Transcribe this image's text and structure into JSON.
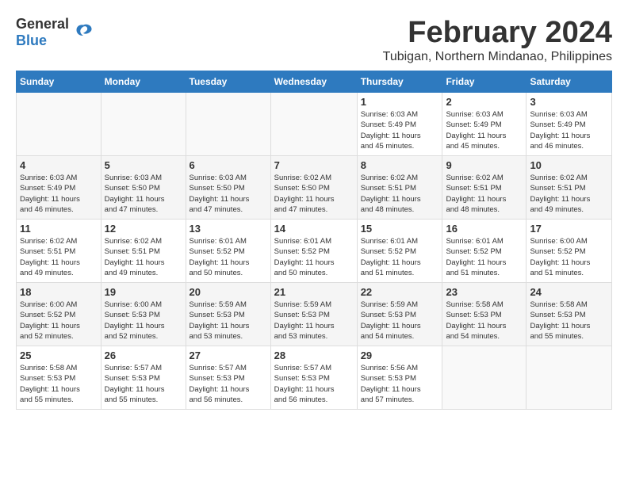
{
  "logo": {
    "general": "General",
    "blue": "Blue"
  },
  "title": {
    "month_year": "February 2024",
    "location": "Tubigan, Northern Mindanao, Philippines"
  },
  "days_of_week": [
    "Sunday",
    "Monday",
    "Tuesday",
    "Wednesday",
    "Thursday",
    "Friday",
    "Saturday"
  ],
  "weeks": [
    [
      {
        "day": "",
        "info": ""
      },
      {
        "day": "",
        "info": ""
      },
      {
        "day": "",
        "info": ""
      },
      {
        "day": "",
        "info": ""
      },
      {
        "day": "1",
        "info": "Sunrise: 6:03 AM\nSunset: 5:49 PM\nDaylight: 11 hours\nand 45 minutes."
      },
      {
        "day": "2",
        "info": "Sunrise: 6:03 AM\nSunset: 5:49 PM\nDaylight: 11 hours\nand 45 minutes."
      },
      {
        "day": "3",
        "info": "Sunrise: 6:03 AM\nSunset: 5:49 PM\nDaylight: 11 hours\nand 46 minutes."
      }
    ],
    [
      {
        "day": "4",
        "info": "Sunrise: 6:03 AM\nSunset: 5:49 PM\nDaylight: 11 hours\nand 46 minutes."
      },
      {
        "day": "5",
        "info": "Sunrise: 6:03 AM\nSunset: 5:50 PM\nDaylight: 11 hours\nand 47 minutes."
      },
      {
        "day": "6",
        "info": "Sunrise: 6:03 AM\nSunset: 5:50 PM\nDaylight: 11 hours\nand 47 minutes."
      },
      {
        "day": "7",
        "info": "Sunrise: 6:02 AM\nSunset: 5:50 PM\nDaylight: 11 hours\nand 47 minutes."
      },
      {
        "day": "8",
        "info": "Sunrise: 6:02 AM\nSunset: 5:51 PM\nDaylight: 11 hours\nand 48 minutes."
      },
      {
        "day": "9",
        "info": "Sunrise: 6:02 AM\nSunset: 5:51 PM\nDaylight: 11 hours\nand 48 minutes."
      },
      {
        "day": "10",
        "info": "Sunrise: 6:02 AM\nSunset: 5:51 PM\nDaylight: 11 hours\nand 49 minutes."
      }
    ],
    [
      {
        "day": "11",
        "info": "Sunrise: 6:02 AM\nSunset: 5:51 PM\nDaylight: 11 hours\nand 49 minutes."
      },
      {
        "day": "12",
        "info": "Sunrise: 6:02 AM\nSunset: 5:51 PM\nDaylight: 11 hours\nand 49 minutes."
      },
      {
        "day": "13",
        "info": "Sunrise: 6:01 AM\nSunset: 5:52 PM\nDaylight: 11 hours\nand 50 minutes."
      },
      {
        "day": "14",
        "info": "Sunrise: 6:01 AM\nSunset: 5:52 PM\nDaylight: 11 hours\nand 50 minutes."
      },
      {
        "day": "15",
        "info": "Sunrise: 6:01 AM\nSunset: 5:52 PM\nDaylight: 11 hours\nand 51 minutes."
      },
      {
        "day": "16",
        "info": "Sunrise: 6:01 AM\nSunset: 5:52 PM\nDaylight: 11 hours\nand 51 minutes."
      },
      {
        "day": "17",
        "info": "Sunrise: 6:00 AM\nSunset: 5:52 PM\nDaylight: 11 hours\nand 51 minutes."
      }
    ],
    [
      {
        "day": "18",
        "info": "Sunrise: 6:00 AM\nSunset: 5:52 PM\nDaylight: 11 hours\nand 52 minutes."
      },
      {
        "day": "19",
        "info": "Sunrise: 6:00 AM\nSunset: 5:53 PM\nDaylight: 11 hours\nand 52 minutes."
      },
      {
        "day": "20",
        "info": "Sunrise: 5:59 AM\nSunset: 5:53 PM\nDaylight: 11 hours\nand 53 minutes."
      },
      {
        "day": "21",
        "info": "Sunrise: 5:59 AM\nSunset: 5:53 PM\nDaylight: 11 hours\nand 53 minutes."
      },
      {
        "day": "22",
        "info": "Sunrise: 5:59 AM\nSunset: 5:53 PM\nDaylight: 11 hours\nand 54 minutes."
      },
      {
        "day": "23",
        "info": "Sunrise: 5:58 AM\nSunset: 5:53 PM\nDaylight: 11 hours\nand 54 minutes."
      },
      {
        "day": "24",
        "info": "Sunrise: 5:58 AM\nSunset: 5:53 PM\nDaylight: 11 hours\nand 55 minutes."
      }
    ],
    [
      {
        "day": "25",
        "info": "Sunrise: 5:58 AM\nSunset: 5:53 PM\nDaylight: 11 hours\nand 55 minutes."
      },
      {
        "day": "26",
        "info": "Sunrise: 5:57 AM\nSunset: 5:53 PM\nDaylight: 11 hours\nand 55 minutes."
      },
      {
        "day": "27",
        "info": "Sunrise: 5:57 AM\nSunset: 5:53 PM\nDaylight: 11 hours\nand 56 minutes."
      },
      {
        "day": "28",
        "info": "Sunrise: 5:57 AM\nSunset: 5:53 PM\nDaylight: 11 hours\nand 56 minutes."
      },
      {
        "day": "29",
        "info": "Sunrise: 5:56 AM\nSunset: 5:53 PM\nDaylight: 11 hours\nand 57 minutes."
      },
      {
        "day": "",
        "info": ""
      },
      {
        "day": "",
        "info": ""
      }
    ]
  ]
}
